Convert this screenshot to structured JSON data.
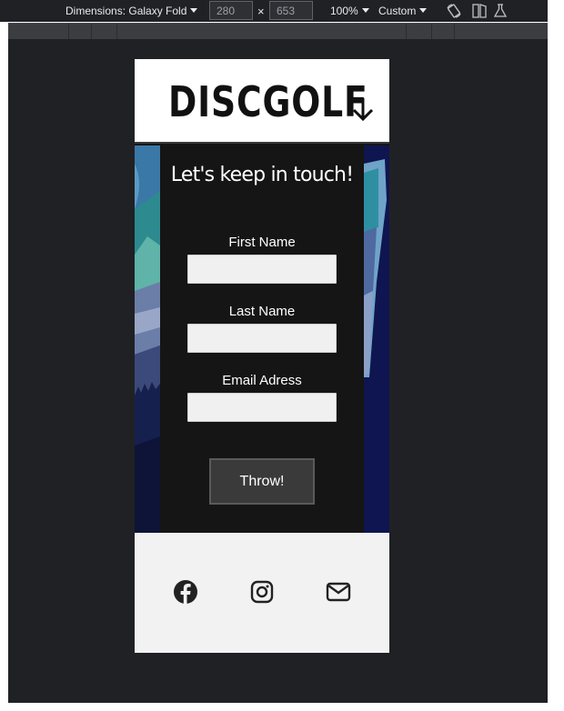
{
  "devtools": {
    "dimensions_label": "Dimensions: Galaxy Fold",
    "width_value": "280",
    "height_value": "653",
    "times_sign": "×",
    "zoom": "100%",
    "throttle": "Custom"
  },
  "site": {
    "logo": "DISCGOLF",
    "menu_icon": "arrow-down-icon"
  },
  "contact_form": {
    "title": "Let's keep in touch!",
    "fields": [
      {
        "label": "First Name",
        "value": ""
      },
      {
        "label": "Last Name",
        "value": ""
      },
      {
        "label": "Email Adress",
        "value": ""
      }
    ],
    "submit_label": "Throw!"
  },
  "footer": {
    "icons": [
      "facebook-icon",
      "instagram-icon",
      "mail-icon"
    ]
  },
  "colors": {
    "devtools_bg": "#202124",
    "panel_bg": "#151515",
    "footer_bg": "#f2f2f2",
    "button_bg": "#3a3a3a"
  }
}
